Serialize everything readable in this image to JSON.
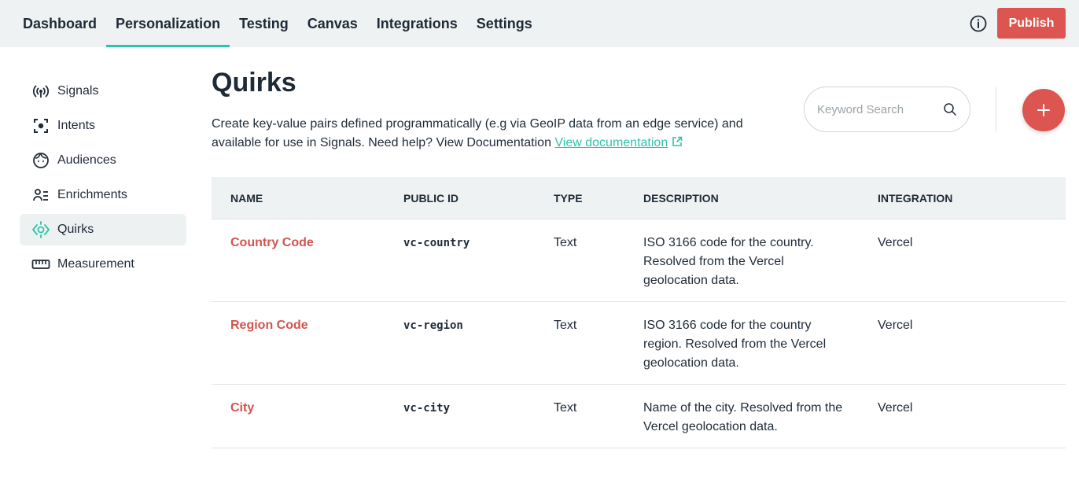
{
  "nav": {
    "tabs": [
      {
        "label": "Dashboard"
      },
      {
        "label": "Personalization"
      },
      {
        "label": "Testing"
      },
      {
        "label": "Canvas"
      },
      {
        "label": "Integrations"
      },
      {
        "label": "Settings"
      }
    ],
    "active_tab": "Personalization",
    "publish_label": "Publish"
  },
  "sidebar": {
    "items": [
      {
        "label": "Signals",
        "icon": "signals-icon"
      },
      {
        "label": "Intents",
        "icon": "intents-icon"
      },
      {
        "label": "Audiences",
        "icon": "audiences-icon"
      },
      {
        "label": "Enrichments",
        "icon": "enrichments-icon"
      },
      {
        "label": "Quirks",
        "icon": "quirks-icon"
      },
      {
        "label": "Measurement",
        "icon": "measurement-icon"
      }
    ],
    "active_item": "Quirks"
  },
  "main": {
    "title": "Quirks",
    "description": "Create key-value pairs defined programmatically (e.g via GeoIP data from an edge service) and available for use in Signals. Need help? View Documentation ",
    "doc_link_label": "View documentation",
    "search": {
      "placeholder": "Keyword Search",
      "value": ""
    }
  },
  "table": {
    "headers": [
      "NAME",
      "PUBLIC ID",
      "TYPE",
      "DESCRIPTION",
      "INTEGRATION"
    ],
    "rows": [
      {
        "name": "Country Code",
        "public_id": "vc-country",
        "type": "Text",
        "description": "ISO 3166 code for the country. Resolved from the Vercel geolocation data.",
        "integration": "Vercel"
      },
      {
        "name": "Region Code",
        "public_id": "vc-region",
        "type": "Text",
        "description": "ISO 3166 code for the country region. Resolved from the Vercel geolocation data.",
        "integration": "Vercel"
      },
      {
        "name": "City",
        "public_id": "vc-city",
        "type": "Text",
        "description": "Name of the city. Resolved from the Vercel geolocation data.",
        "integration": "Vercel"
      }
    ]
  },
  "colors": {
    "accent": "#2cc4a6",
    "brand_red": "#dc5550",
    "name_red": "#d4534e",
    "nav_bg": "#eef2f2"
  }
}
